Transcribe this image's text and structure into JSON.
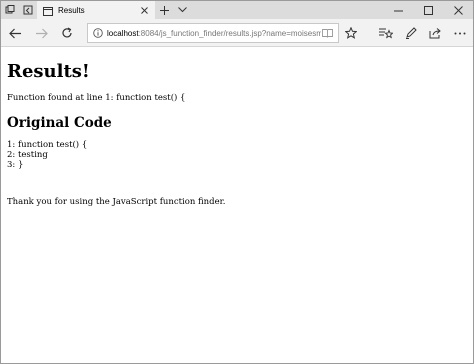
{
  "tabs": [
    {
      "label": "Results"
    }
  ],
  "icons": {
    "tab_manager": "tab-manager-icon",
    "tab_back": "set-aside-tabs-icon",
    "page": "page-icon",
    "close": "close-icon",
    "new_tab": "plus-icon",
    "tab_menu": "chevron-down-icon",
    "minimize": "minimize-icon",
    "maximize": "maximize-icon",
    "window_close": "close-icon",
    "back": "back-arrow-icon",
    "forward": "forward-arrow-icon",
    "refresh": "refresh-icon",
    "info": "info-icon",
    "reader": "reading-view-icon",
    "favorite": "star-icon",
    "favorites_hub": "favorites-list-icon",
    "notes": "pen-icon",
    "share": "share-icon",
    "more": "more-icon"
  },
  "address": {
    "host": "localhost",
    "rest": ":8084/js_function_finder/results.jsp?name=moisesmcar"
  },
  "page": {
    "heading": "Results!",
    "found_text": "Function found at line 1: function test() {",
    "code_heading": "Original Code",
    "code_lines": [
      "1: function test() {",
      "2: testing",
      "3: }"
    ],
    "thanks_text": "Thank you for using the JavaScript function finder."
  }
}
